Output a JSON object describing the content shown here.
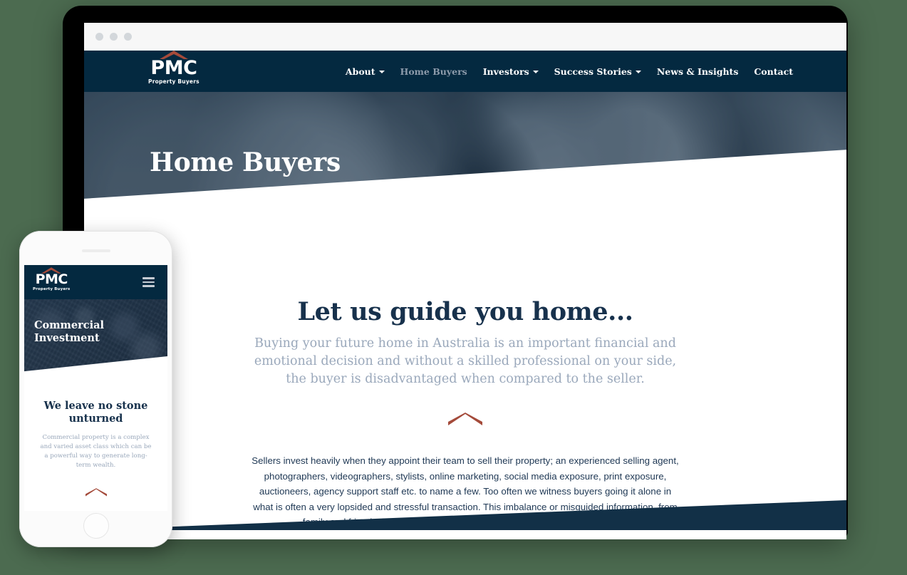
{
  "colors": {
    "page_background": "#4c6b50",
    "navy": "#042940",
    "rust_accent": "#a44a3a",
    "heading_navy": "#17314c",
    "muted_blue": "#9aa8bb",
    "body_text": "#213a56"
  },
  "browser": {
    "dots": [
      "close-dot",
      "minimize-dot",
      "maximize-dot"
    ]
  },
  "desktop": {
    "logo": {
      "name": "PMC",
      "tagline": "Property Buyers",
      "roof_icon": "roof-chevron-icon"
    },
    "nav": [
      {
        "label": "About",
        "has_dropdown": true,
        "active": false
      },
      {
        "label": "Home Buyers",
        "has_dropdown": false,
        "active": true
      },
      {
        "label": "Investors",
        "has_dropdown": true,
        "active": false
      },
      {
        "label": "Success Stories",
        "has_dropdown": true,
        "active": false
      },
      {
        "label": "News & Insights",
        "has_dropdown": false,
        "active": false
      },
      {
        "label": "Contact",
        "has_dropdown": false,
        "active": false
      }
    ],
    "hero": {
      "title": "Home Buyers"
    },
    "section": {
      "heading": "Let us guide you home...",
      "lede": "Buying your future home in Australia is an important financial and emotional decision and without a skilled professional on your side, the buyer is disadvantaged when compared to the seller.",
      "divider_icon": "chevron-divider-icon",
      "body": "Sellers invest heavily when they appoint their team to sell their property; an experienced selling agent, photographers, videographers, stylists, online marketing, social media exposure, print exposure, auctioneers, agency support staff etc. to name a few. Too often we witness buyers going it alone in what is often a very lopsided and stressful transaction. This imbalance or misguided information, from family and friends, is what leads to costly mistakes. We help you to avoid this."
    }
  },
  "phone": {
    "logo": {
      "name": "PMC",
      "tagline": "Property Buyers",
      "roof_icon": "roof-chevron-icon"
    },
    "menu_icon": "hamburger-menu-icon",
    "hero": {
      "title_line1": "Commercial",
      "title_line2": "Investment"
    },
    "section": {
      "heading": "We leave no stone unturned",
      "body": "Commercial property is a complex and varied asset class which can be a powerful way to generate long-term wealth.",
      "divider_icon": "chevron-divider-icon"
    },
    "home_button": "home-button"
  }
}
